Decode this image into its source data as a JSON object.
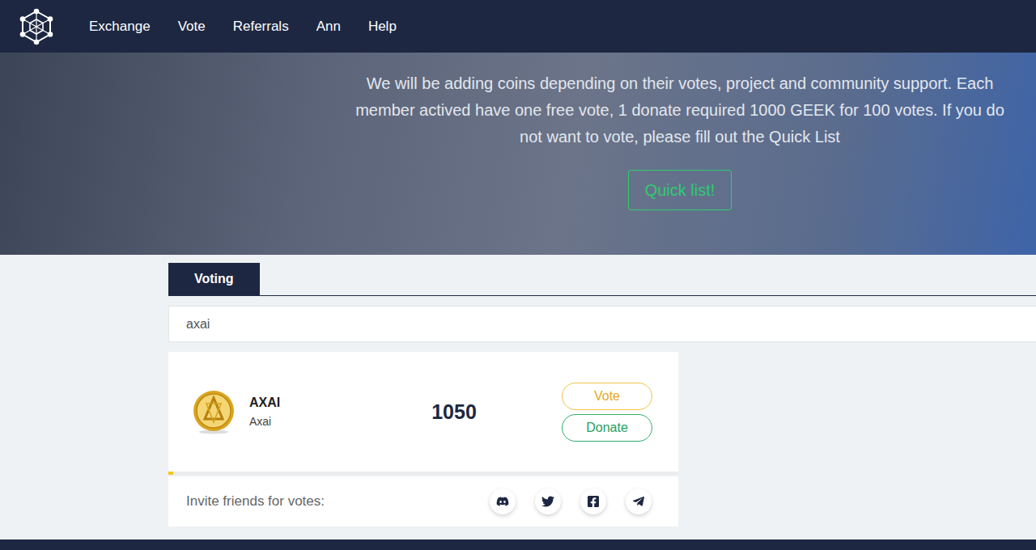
{
  "nav": {
    "items": [
      "Exchange",
      "Vote",
      "Referrals",
      "Ann",
      "Help"
    ]
  },
  "hero": {
    "text": "We will be adding coins depending on their votes, project and community support. Each member actived have one free vote, 1 donate required 1000 GEEK for 100 votes. If you do not want to vote, please fill out the Quick List",
    "button": "Quick list!"
  },
  "tabs": [
    {
      "label": "Voting",
      "selected": true
    }
  ],
  "search": {
    "value": "axai"
  },
  "coins": [
    {
      "symbol": "AXAI",
      "name": "Axai",
      "votes": "1050",
      "level": 0.01,
      "buttons": [
        {
          "label": "Vote",
          "kind": "vote"
        },
        {
          "label": "Donate",
          "kind": "donate"
        }
      ]
    }
  ],
  "share": {
    "label": "Invite friends for votes:"
  }
}
